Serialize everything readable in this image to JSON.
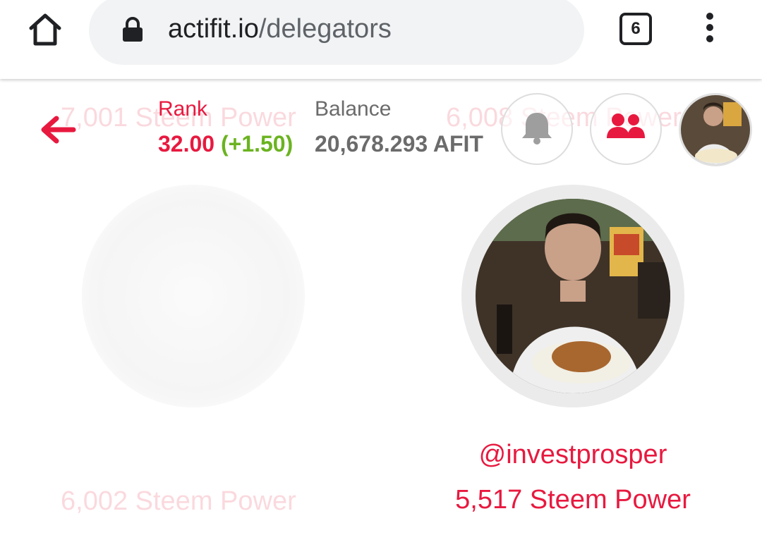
{
  "browser": {
    "url_domain": "actifit.io",
    "url_path": "/delegators",
    "tab_count": "6",
    "icons": [
      "home-icon",
      "lock-icon",
      "tabs-icon",
      "more-vert-icon"
    ]
  },
  "header": {
    "rank_label": "Rank",
    "rank_value": "32.00",
    "rank_change": "(+1.50)",
    "balance_label": "Balance",
    "balance_value": "20,678.293 AFIT",
    "icons": [
      "back-arrow-icon",
      "bell-icon",
      "friends-icon",
      "user-avatar"
    ]
  },
  "ghost_content": {
    "top_left_power": "7,001 Steem Power",
    "top_right_power": "6,008 Steem Power",
    "bottom_left_power": "6,002 Steem Power"
  },
  "delegators": [
    {
      "name": "@investprosper",
      "power": "5,517 Steem Power"
    }
  ],
  "colors": {
    "accent": "#e8193f",
    "positive": "#6bb320",
    "muted": "#6b6b6b"
  }
}
